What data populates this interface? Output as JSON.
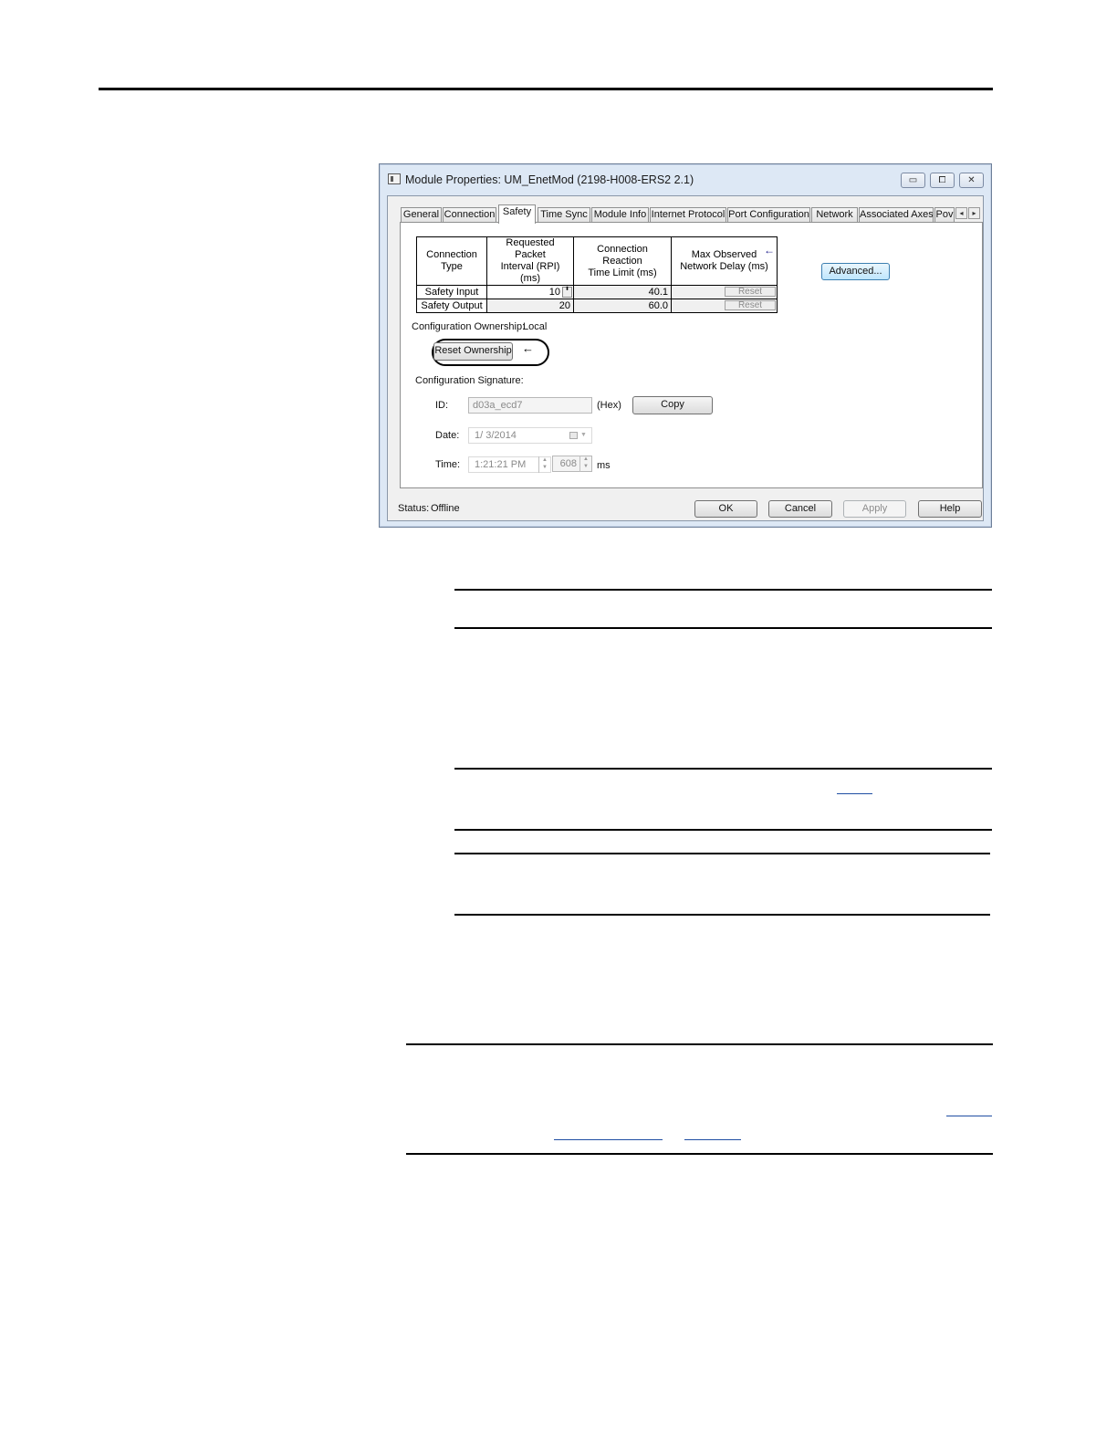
{
  "window": {
    "title": "Module Properties: UM_EnetMod (2198-H008-ERS2 2.1)",
    "controls": {
      "minimize": "▭",
      "maximize": "⧠",
      "close": "✕"
    }
  },
  "tabs": [
    {
      "label": "General"
    },
    {
      "label": "Connection"
    },
    {
      "label": "Safety"
    },
    {
      "label": "Time Sync"
    },
    {
      "label": "Module Info"
    },
    {
      "label": "Internet Protocol"
    },
    {
      "label": "Port Configuration"
    },
    {
      "label": "Network"
    },
    {
      "label": "Associated Axes"
    },
    {
      "label": "Pov"
    }
  ],
  "tab_scroll": {
    "left": "◂",
    "right": "▸"
  },
  "connection_table": {
    "headers": [
      {
        "line1": "Connection",
        "line2": "Type"
      },
      {
        "line1": "Requested Packet",
        "line2": "Interval (RPI) (ms)"
      },
      {
        "line1": "Connection Reaction",
        "line2": "Time Limit (ms)"
      },
      {
        "line1": "Max Observed",
        "line2": "Network Delay (ms)"
      }
    ],
    "rows": [
      {
        "type": "Safety Input",
        "rpi": "10",
        "reaction": "40.1",
        "delay": "",
        "reset": "Reset"
      },
      {
        "type": "Safety Output",
        "rpi": "20",
        "reaction": "60.0",
        "delay": "",
        "reset": "Reset"
      }
    ],
    "spin_glyph": "⬍"
  },
  "arrow_glyph": "←",
  "advanced_button": "Advanced...",
  "ownership": {
    "label": "Configuration Ownership:",
    "value": "Local",
    "reset_button": "Reset Ownership"
  },
  "signature": {
    "heading": "Configuration Signature:",
    "id_label": "ID:",
    "id_value": "d03a_ecd7",
    "hex_label": "(Hex)",
    "copy_button": "Copy",
    "date_label": "Date:",
    "date_value": "1/  3/2014",
    "time_label": "Time:",
    "time_value": "1:21:21 PM",
    "ms_value": "608",
    "ms_label": "ms"
  },
  "status": {
    "label": "Status:",
    "value": "Offline"
  },
  "buttons": {
    "ok": "OK",
    "cancel": "Cancel",
    "apply": "Apply",
    "help": "Help"
  }
}
